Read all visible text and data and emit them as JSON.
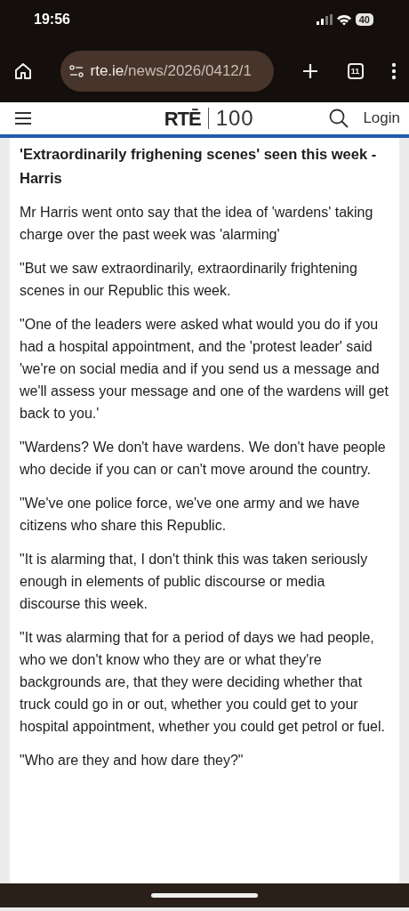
{
  "status_bar": {
    "time": "19:56",
    "battery": "40"
  },
  "browser": {
    "url_host": "rte.ie",
    "url_path": "/news/2026/0412/1",
    "tab_count": "11"
  },
  "site_header": {
    "logo": "RTĒ",
    "logo_suffix": "100",
    "login": "Login"
  },
  "article": {
    "heading": "'Extraordinarily frighening scenes' seen this week - Harris",
    "paragraphs": [
      "Mr Harris went onto say that the idea of 'wardens' taking charge over the past week was 'alarming'",
      "\"But we saw extraordinarily, extraordinarily frightening scenes in our Republic this week.",
      "\"One of the leaders were asked what would you do if you had a hospital appointment, and the 'protest leader' said 'we're on social media and if you send us a message and we'll assess your message and one of the wardens will get back to you.'",
      "\"Wardens? We don't have wardens. We don't have people who decide if you can or can't move around the country.",
      "\"We've one police force, we've one army and we have citizens who share this Republic.",
      "\"It is alarming that, I don't think this was taken seriously enough in elements of public discourse or media discourse this week.",
      "\"It was alarming that for a period of days we had people, who we don't know who they are or what they're backgrounds are, that they were deciding whether that truck could go in or out, whether you could get to your hospital appointment, whether you could get petrol or fuel.",
      "\"Who are they and how dare they?\""
    ]
  }
}
